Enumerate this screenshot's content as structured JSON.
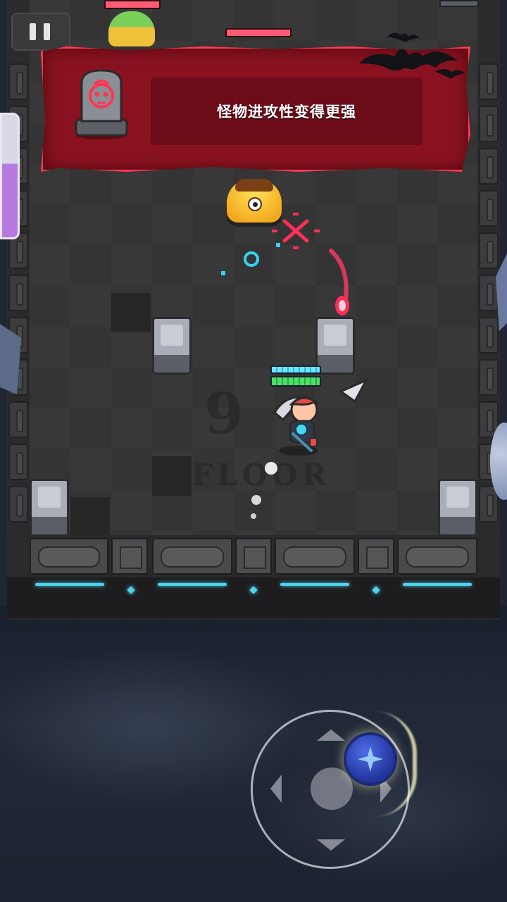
{
  "hud": {
    "pause_icon": "pause-icon"
  },
  "banner": {
    "message": "怪物进攻性变得更强",
    "icon": "tombstone-skull-icon",
    "decoration": "bats-icon"
  },
  "floor_marker": {
    "number": "9",
    "word": "FLOOR"
  },
  "joystick": {
    "knob_icon": "sparkle-icon"
  },
  "colors": {
    "banner_red": "#8a1220",
    "banner_glow": "#ff3b58",
    "neon_cyan": "#4fd2ea",
    "player_hp_green": "#4fe06a",
    "player_shield_cyan": "#6ee6ff",
    "enemy_hp": "#ff5a74"
  }
}
